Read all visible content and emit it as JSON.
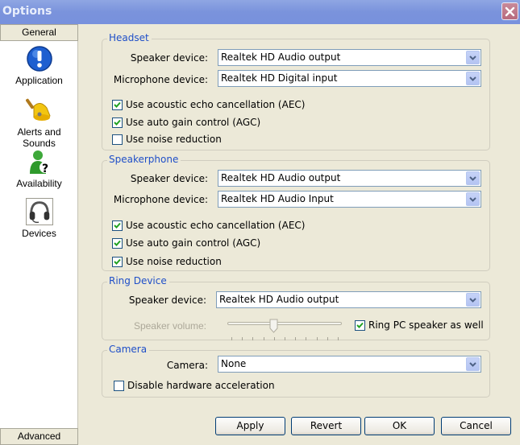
{
  "window": {
    "title": "Options",
    "close_label": "close"
  },
  "sidebar": {
    "top_tab": "General",
    "bottom_tab": "Advanced",
    "items": [
      {
        "label": "Application",
        "icon": "info-icon"
      },
      {
        "label": "Alerts and Sounds",
        "icon": "bell-icon"
      },
      {
        "label": "Availability",
        "icon": "availability-icon"
      },
      {
        "label": "Devices",
        "icon": "headset-icon",
        "selected": true
      }
    ]
  },
  "headset": {
    "title": "Headset",
    "speaker_label": "Speaker device:",
    "speaker_value": "Realtek HD Audio output",
    "mic_label": "Microphone device:",
    "mic_value": "Realtek HD Digital input",
    "aec_label": "Use acoustic echo cancellation (AEC)",
    "aec_checked": true,
    "agc_label": "Use auto gain control (AGC)",
    "agc_checked": true,
    "nr_label": "Use noise reduction",
    "nr_checked": false
  },
  "speakerphone": {
    "title": "Speakerphone",
    "speaker_label": "Speaker device:",
    "speaker_value": "Realtek HD Audio output",
    "mic_label": "Microphone device:",
    "mic_value": "Realtek HD Audio Input",
    "aec_label": "Use acoustic echo cancellation (AEC)",
    "aec_checked": true,
    "agc_label": "Use auto gain control (AGC)",
    "agc_checked": true,
    "nr_label": "Use noise reduction",
    "nr_checked": true
  },
  "ring": {
    "title": "Ring Device",
    "speaker_label": "Speaker device:",
    "speaker_value": "Realtek HD Audio output",
    "volume_label": "Speaker volume:",
    "volume_fraction": 0.4,
    "volume_ticks": 11,
    "pc_speaker_label": "Ring PC speaker as well",
    "pc_speaker_checked": true
  },
  "camera": {
    "title": "Camera",
    "camera_label": "Camera:",
    "camera_value": "None",
    "hw_accel_label": "Disable hardware acceleration",
    "hw_accel_checked": false
  },
  "buttons": {
    "apply": "Apply",
    "revert": "Revert",
    "ok": "OK",
    "cancel": "Cancel"
  },
  "colors": {
    "legend": "#1f4fc8",
    "check": "#21a121",
    "titlebar": "#7a93dc"
  }
}
